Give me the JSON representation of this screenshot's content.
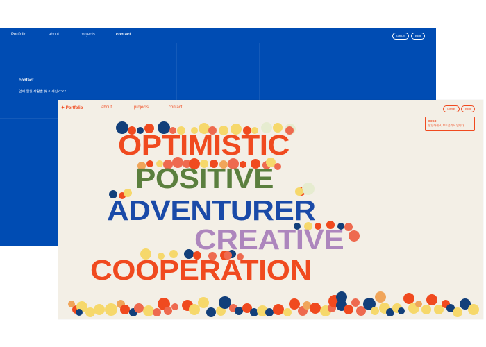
{
  "back_window": {
    "nav": {
      "brand": "Portfolio",
      "links": [
        "about",
        "projects",
        "contact"
      ],
      "buttons": [
        "Github",
        "Blog"
      ]
    },
    "contact": {
      "heading": "contact",
      "text": "함께 일할 사람을 찾고 계신가요?"
    },
    "background_color": "#004cb3"
  },
  "front_window": {
    "nav": {
      "brand": "Portfolio",
      "brand_icon": "star-icon",
      "links": [
        "about",
        "projects",
        "contact"
      ],
      "buttons": [
        "Github",
        "Blog"
      ]
    },
    "desc": {
      "title": "desc",
      "text": "안녕하세요, 포트폴리오 입니다."
    },
    "words": [
      {
        "text": "OPTIMISTIC",
        "color": "#f04a1f"
      },
      {
        "text": "POSITIVE",
        "color": "#5b7f3e"
      },
      {
        "text": "ADVENTURER",
        "color": "#1a4aa8"
      },
      {
        "text": "CREATIVE",
        "color": "#ad86bd"
      },
      {
        "text": "COOPERATION",
        "color": "#f04a1f"
      }
    ],
    "palette": {
      "orange": "#f04a1f",
      "coral": "#ee6a4f",
      "yellow": "#f6d86b",
      "peach": "#f0a55a",
      "navy": "#123f7a",
      "pale": "#e6ecd0",
      "background": "#f3efe6"
    }
  }
}
